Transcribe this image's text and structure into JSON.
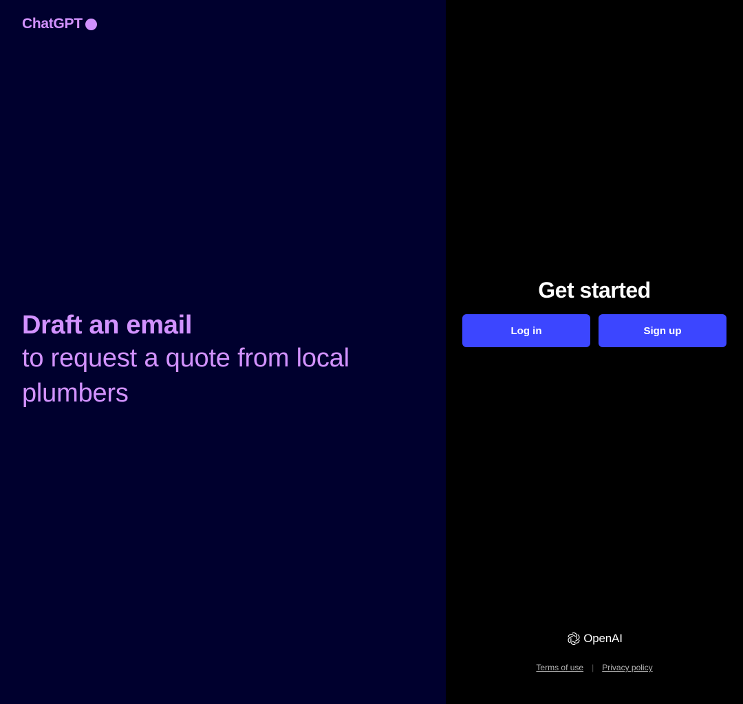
{
  "brand": {
    "name": "ChatGPT",
    "dot_icon": "circle-dot-icon",
    "color": "#d292ff"
  },
  "hero": {
    "headline_bold": "Draft an email",
    "headline_rest": "to request a quote from local plumbers"
  },
  "auth": {
    "title": "Get started",
    "login_label": "Log in",
    "signup_label": "Sign up",
    "button_color": "#3c46ff"
  },
  "footer": {
    "logo_icon": "openai-knot-icon",
    "logo_text": "OpenAI",
    "terms_label": "Terms of use",
    "separator": "|",
    "privacy_label": "Privacy policy"
  },
  "colors": {
    "left_bg": "#00002e",
    "right_bg": "#000000",
    "accent": "#d292ff"
  }
}
